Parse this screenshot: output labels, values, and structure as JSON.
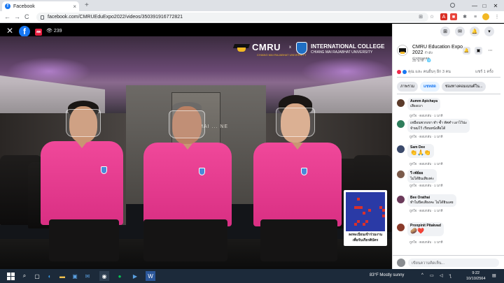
{
  "browser": {
    "tab_title": "Facebook",
    "tab_close": "×",
    "new_tab": "+",
    "url": "facebook.com/CMRUEduExpo2022/videos/350391916772821",
    "back": "←",
    "forward": "→",
    "reload": "C",
    "win_min": "—",
    "win_max": "□",
    "win_close": "✕"
  },
  "viewer": {
    "close": "✕",
    "fb_logo": "f",
    "live_label": "สด",
    "viewer_count": "239"
  },
  "video": {
    "cmru_logo": "CMRU",
    "cmru_tagline": "CHIANG MAI RAJABHAT UNIVERSITY",
    "logo_separator": "x",
    "ic_title": "INTERNATIONAL COLLEGE",
    "ic_subtitle": "CHIANG MAI RAJABHAT UNIVERSITY",
    "back_sign": "CHIANG MAI ... NE",
    "qr_caption_1": "ลงทะเบียนเข้าร่วมงาน",
    "qr_caption_2": "เพื่อรับเกียรติบัตร"
  },
  "panel": {
    "page_name": "CMRU Education Expo 2022",
    "page_name_suffix": "กำลัง",
    "page_name_sub": "ถ่ายทอดสด",
    "page_meta": "35 นาที · 🌐",
    "reactions": "คุณ และ คนอื่นๆ อีก 3 คน",
    "shares": "แชร์ 1 ครั้ง",
    "chips": [
      "ภาพรวม",
      "แชทสด",
      "ช่องทางคอมเมนต์ใน..."
    ],
    "comments": [
      {
        "name": "Aumm Apichaya",
        "text": "เสียงเบา",
        "actions": "ถูกใจ · ตอบกลับ · 1 นาที"
      },
      {
        "name": "",
        "text": "เหมือนพวกเขา ทำ ซ้ำ ทัศคำ เอาไว้น่ะ",
        "text2": "จำผมไว้ เรียนหนังสือได้",
        "actions": "ถูกใจ · ตอบกลับ · 1 นาที"
      },
      {
        "name": "Sam Dee",
        "text": "👏🙏👏",
        "actions": "ถูกใจ · ตอบกลับ · 1 นาที"
      },
      {
        "name": "วี เฟ่ย์ออ",
        "text": "ไม่ได้ยินเสียงค่ะ",
        "actions": "ถูกใจ · ตอบกลับ · 1 นาที"
      },
      {
        "name": "Bee Orathai",
        "text": "ทำไมปิดเสียงคะ ไม่ได้ยินเลย",
        "actions": "ถูกใจ · ตอบกลับ · 1 นาที"
      },
      {
        "name": "Pronpinit Pitakvad",
        "text": "🥔❤️",
        "actions": "ถูกใจ · ตอบกลับ · 1 นาที"
      }
    ],
    "composer_placeholder": "เขียนความคิดเห็น..."
  },
  "taskbar": {
    "weather": "83°F  Mostly sunny",
    "time": "9:22",
    "date": "10/10/2564"
  }
}
